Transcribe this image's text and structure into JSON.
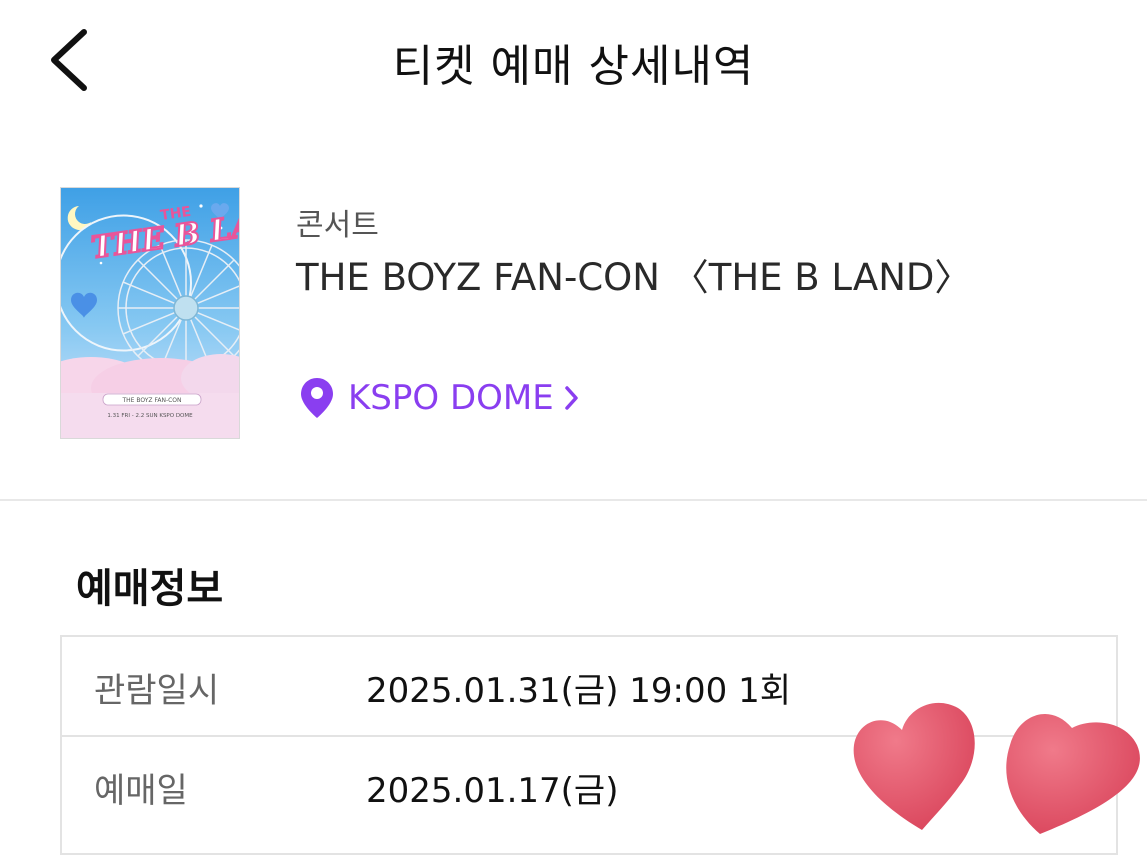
{
  "header": {
    "title": "티켓 예매 상세내역",
    "back_icon": "chevron-left-icon"
  },
  "event": {
    "poster": {
      "title_text": "THE B LAND",
      "small_title": "THE",
      "caption_line1": "THE BOYZ FAN-CON",
      "caption_line2": "1.31 FRI - 2.2 SUN KSPO DOME"
    },
    "category": "콘서트",
    "title": "THE BOYZ FAN-CON 〈THE B LAND〉",
    "venue": {
      "label": "KSPO DOME",
      "icon": "map-pin-icon",
      "color": "#8a3ef0"
    }
  },
  "booking_info": {
    "section_title": "예매정보",
    "rows": [
      {
        "label": "관람일시",
        "value": "2025.01.31(금) 19:00 1회"
      },
      {
        "label": "예매일",
        "value": "2025.01.17(금)"
      }
    ]
  },
  "decoration": {
    "icon": "hearts-sticker-icon",
    "color": "#e8596d"
  }
}
